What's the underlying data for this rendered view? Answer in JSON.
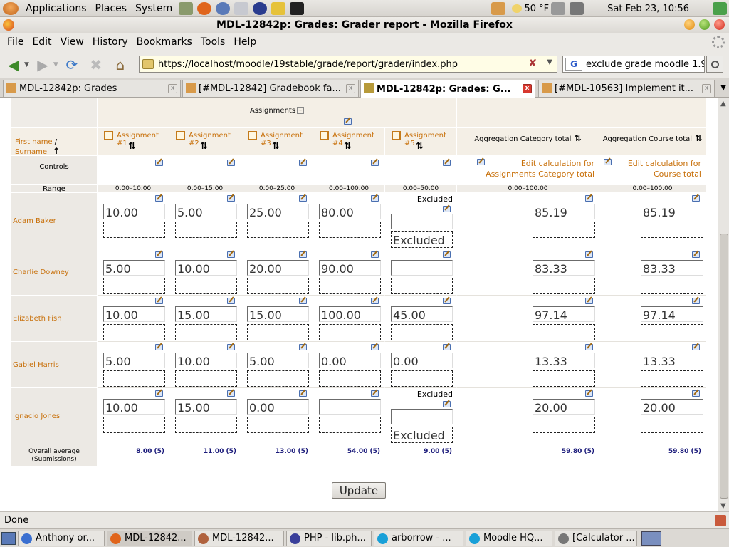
{
  "os_menu": {
    "applications": "Applications",
    "places": "Places",
    "system": "System"
  },
  "weather": "50 °F",
  "clock": "Sat Feb 23, 10:56",
  "window_title": "MDL-12842p: Grades: Grader report - Mozilla Firefox",
  "menubar": {
    "file": "File",
    "edit": "Edit",
    "view": "View",
    "history": "History",
    "bookmarks": "Bookmarks",
    "tools": "Tools",
    "help": "Help"
  },
  "url": "https://localhost/moodle/19stable/grade/report/grader/index.php",
  "search_value": "exclude grade moodle 1.9",
  "tabs": [
    {
      "label": "MDL-12842p: Grades"
    },
    {
      "label": "[#MDL-12842] Gradebook fa..."
    },
    {
      "label": "MDL-12842p: Grades: G..."
    },
    {
      "label": "[#MDL-10563] Implement it..."
    }
  ],
  "grid": {
    "category_label": "Assignments",
    "collapse_symbol": "–",
    "name_header": {
      "first": "First name",
      "sep": " / ",
      "last": "Surname",
      "sort": "↑"
    },
    "columns": [
      {
        "label": "Assignment #1"
      },
      {
        "label": "Assignment #2"
      },
      {
        "label": "Assignment #3"
      },
      {
        "label": "Assignment #4"
      },
      {
        "label": "Assignment #5"
      }
    ],
    "category_total": {
      "prefix": "Aggregation",
      "label": "Category total"
    },
    "course_total": {
      "prefix": "Aggregation",
      "label": "Course total"
    },
    "controls_label": "Controls",
    "edit_calc_assignments": "Edit calculation for Assignments Category total",
    "edit_calc_course": "Edit calculation for Course total",
    "range_label": "Range",
    "ranges": [
      "0.00–10.00",
      "0.00–15.00",
      "0.00–25.00",
      "0.00–100.00",
      "0.00–50.00",
      "0.00–100.00",
      "0.00–100.00"
    ],
    "excluded_label": "Excluded",
    "students": [
      {
        "name": "Adam Baker",
        "grades": [
          "10.00",
          "5.00",
          "25.00",
          "80.00",
          ""
        ],
        "excluded": [
          false,
          false,
          false,
          false,
          true
        ],
        "cat": "85.19",
        "course": "85.19"
      },
      {
        "name": "Charlie Downey",
        "grades": [
          "5.00",
          "10.00",
          "20.00",
          "90.00",
          ""
        ],
        "excluded": [
          false,
          false,
          false,
          false,
          false
        ],
        "cat": "83.33",
        "course": "83.33"
      },
      {
        "name": "Elizabeth Fish",
        "grades": [
          "10.00",
          "15.00",
          "15.00",
          "100.00",
          "45.00"
        ],
        "excluded": [
          false,
          false,
          false,
          false,
          false
        ],
        "cat": "97.14",
        "course": "97.14"
      },
      {
        "name": "Gabiel Harris",
        "grades": [
          "5.00",
          "10.00",
          "5.00",
          "0.00",
          "0.00"
        ],
        "excluded": [
          false,
          false,
          false,
          false,
          false
        ],
        "cat": "13.33",
        "course": "13.33"
      },
      {
        "name": "Ignacio Jones",
        "grades": [
          "10.00",
          "15.00",
          "0.00",
          "",
          ""
        ],
        "excluded": [
          false,
          false,
          false,
          false,
          true
        ],
        "cat": "20.00",
        "course": "20.00"
      }
    ],
    "overall_label": "Overall average (Submissions)",
    "averages": [
      "8.00 (5)",
      "11.00 (5)",
      "13.00 (5)",
      "54.00 (5)",
      "9.00 (5)",
      "59.80 (5)",
      "59.80 (5)"
    ]
  },
  "update_button": "Update",
  "status": "Done",
  "taskbar": [
    {
      "label": "Anthony or...",
      "color": "#3a6fd0"
    },
    {
      "label": "MDL-12842...",
      "color": "#e0651c"
    },
    {
      "label": "MDL-12842...",
      "color": "#b0623e"
    },
    {
      "label": "PHP - lib.ph...",
      "color": "#3a3f9a"
    },
    {
      "label": "arborrow - ...",
      "color": "#19a0d8"
    },
    {
      "label": "Moodle HQ...",
      "color": "#19a0d8"
    },
    {
      "label": "[Calculator ...",
      "color": "#777777"
    }
  ]
}
